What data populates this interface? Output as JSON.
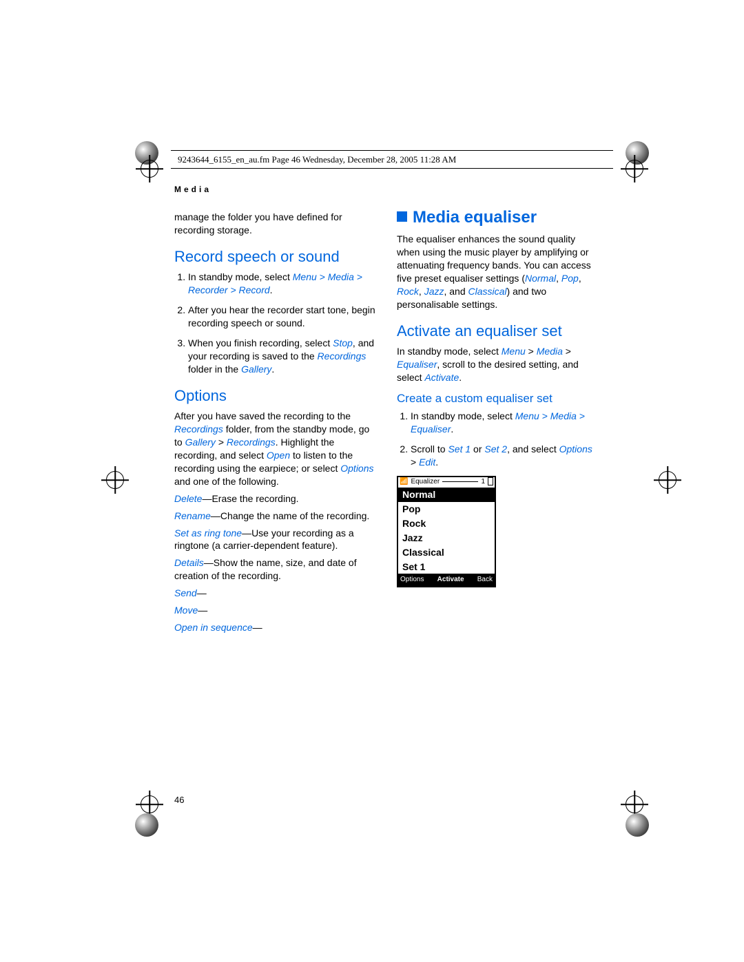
{
  "header": {
    "runline": "9243644_6155_en_au.fm  Page 46  Wednesday, December 28, 2005  11:28 AM",
    "section_label": "Media"
  },
  "left_column": {
    "intro": "manage the folder you have defined for recording storage.",
    "h_record": "Record speech or sound",
    "rec_steps": [
      {
        "num": "1.",
        "pre": "In standby mode, select ",
        "link": "Menu > Media > Recorder > Record",
        "post": "."
      },
      {
        "num": "2.",
        "text": "After you hear the recorder start tone, begin recording speech or sound."
      },
      {
        "num": "3.",
        "pre": "When you finish recording, select ",
        "link1": "Stop",
        "mid": ", and your recording is saved to the ",
        "link2": "Recordings",
        "mid2": " folder in the ",
        "link3": "Gallery",
        "post": "."
      }
    ],
    "h_options": "Options",
    "opt_intro": {
      "pre": "After you have saved the recording to the ",
      "l1": "Recordings",
      "m1": " folder, from the standby mode, go to ",
      "l2": "Gallery",
      "m2": " > ",
      "l3": "Recordings",
      "m3": ". Highlight the recording, and select ",
      "l4": "Open",
      "m4": " to listen to the recording using the earpiece; or select ",
      "l5": "Options",
      "post": " and one of the following."
    },
    "opts": [
      {
        "label": "Delete",
        "desc": "—Erase the recording."
      },
      {
        "label": "Rename",
        "desc": "—Change the name of the recording."
      },
      {
        "label": "Set as ring tone",
        "desc": "—Use your recording as a ringtone (a carrier-dependent feature)."
      },
      {
        "label": "Details",
        "desc": "—Show the name, size, and date of creation of the recording."
      },
      {
        "label": "Send",
        "desc": "—"
      },
      {
        "label": "Move",
        "desc": "—"
      },
      {
        "label": "Open in sequence",
        "desc": "—"
      }
    ]
  },
  "right_column": {
    "h_main": "Media equaliser",
    "eq_intro": {
      "pre": "The equaliser enhances the sound quality when using the music player by amplifying or attenuating frequency bands. You can access five preset equaliser settings (",
      "l1": "Normal",
      "c1": ", ",
      "l2": "Pop",
      "c2": ", ",
      "l3": "Rock",
      "c3": ", ",
      "l4": "Jazz",
      "c4": ", and ",
      "l5": "Classical",
      "post": ") and two personalisable settings."
    },
    "h_activate": "Activate an equaliser set",
    "activate_p": {
      "pre": "In standby mode, select ",
      "l1": "Menu",
      "m1": " > ",
      "l2": "Media",
      "m2": " > ",
      "l3": "Equaliser",
      "m3": ", scroll to the desired setting, and select ",
      "l4": "Activate",
      "post": "."
    },
    "h_custom": "Create a custom equaliser set",
    "cust_steps": [
      {
        "num": "1.",
        "pre": "In standby mode, select ",
        "link": "Menu > Media > Equaliser",
        "post": "."
      },
      {
        "num": "2.",
        "pre": "Scroll to ",
        "l1": "Set 1",
        "mid": " or ",
        "l2": "Set 2",
        "mid2": ", and select ",
        "l3": "Options",
        "mid3": " > ",
        "l4": "Edit",
        "post": "."
      }
    ]
  },
  "phone": {
    "title": "Equalizer",
    "count": "1",
    "items": [
      "Normal",
      "Pop",
      "Rock",
      "Jazz",
      "Classical",
      "Set 1"
    ],
    "soft_left": "Options",
    "soft_mid": "Activate",
    "soft_right": "Back"
  },
  "pagenum": "46"
}
